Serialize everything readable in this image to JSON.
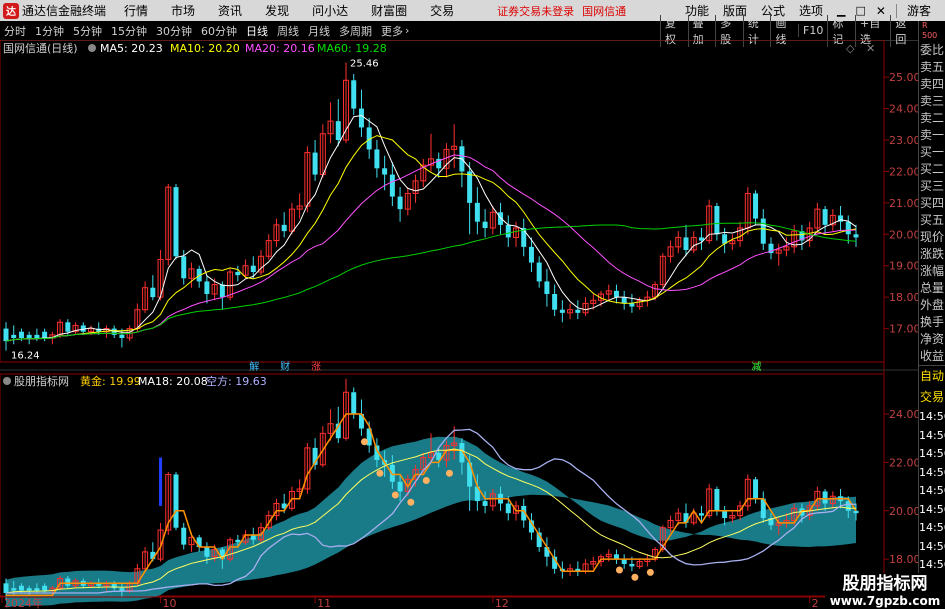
{
  "app": {
    "title": "通达信金融终端",
    "menus": [
      "行情",
      "市场",
      "资讯",
      "发现",
      "问小达",
      "财富圈",
      "交易"
    ],
    "warning": "证券交易未登录",
    "stock_name": "国网信通",
    "right_menus": [
      "功能",
      "版面",
      "公式",
      "选项"
    ],
    "user": "游客"
  },
  "toolbar": {
    "periods": [
      "分时",
      "1分钟",
      "5分钟",
      "15分钟",
      "30分钟",
      "60分钟",
      "日线",
      "周线",
      "月线",
      "多周期",
      "更多"
    ],
    "active_period": "日线",
    "tools": [
      "复权",
      "叠加",
      "多股",
      "统计",
      "画线",
      "F10",
      "标记",
      "+自选",
      "返回"
    ],
    "badge": "R\n500"
  },
  "upper_panel": {
    "label": "国网信通(日线)",
    "ma_labels": [
      {
        "text": "MA5: 20.23",
        "color": "#ffffff"
      },
      {
        "text": "MA10: 20.20",
        "color": "#ffff00"
      },
      {
        "text": "MA20: 20.16",
        "color": "#ff50ff"
      },
      {
        "text": "MA60: 19.28",
        "color": "#00e000"
      }
    ],
    "high_label": "25.46",
    "low_label": "16.24",
    "y_ticks": [
      "25.00",
      "24.00",
      "23.00",
      "22.00",
      "21.00",
      "20.00",
      "19.00",
      "18.00",
      "17.00"
    ],
    "event_markers": [
      {
        "text": "解",
        "color": "#40c0ff"
      },
      {
        "text": "财",
        "color": "#40c0ff"
      },
      {
        "text": "涨",
        "color": "#ff4040"
      },
      {
        "text": "减",
        "color": "#40ff40"
      }
    ]
  },
  "lower_panel": {
    "label": "股朋指标网",
    "values": [
      {
        "text": "黄金: 19.99",
        "color": "#ffcc00"
      },
      {
        "text": "MA18: 20.08",
        "color": "#ffffff"
      },
      {
        "text": "空方: 19.63",
        "color": "#b0b0ff"
      }
    ],
    "y_ticks": [
      "24.00",
      "22.00",
      "20.00",
      "18.00"
    ]
  },
  "x_axis": [
    "2024年",
    "10",
    "11",
    "12",
    "2",
    "3"
  ],
  "right_panel": {
    "quote_rows": [
      "委比",
      "卖五",
      "卖四",
      "卖三",
      "卖二",
      "卖一",
      "买一",
      "买二",
      "买三",
      "买四",
      "买五",
      "现价",
      "涨跌",
      "涨幅",
      "总量",
      "外盘",
      "换手",
      "净资",
      "收益"
    ],
    "auto_label": "自动",
    "trade_label": "交易",
    "times": [
      "14:56",
      "14:56",
      "14:56",
      "14:56",
      "14:56",
      "14:56",
      "14:56",
      "14:56",
      "14:56",
      "14:56"
    ]
  },
  "watermark": {
    "line1": "股朋指标网",
    "line2": "www.7gpzb.com"
  },
  "chart_data": {
    "type": "candlestick",
    "upper_ylim": [
      16.0,
      25.8
    ],
    "lower_ylim": [
      16.6,
      25.2
    ],
    "ohlc": [
      [
        17.0,
        17.2,
        16.6,
        16.3
      ],
      [
        16.8,
        17.1,
        16.7,
        16.5
      ],
      [
        16.9,
        17.0,
        16.7,
        16.6
      ],
      [
        16.8,
        16.9,
        16.7,
        16.5
      ],
      [
        16.8,
        17.0,
        16.7,
        16.6
      ],
      [
        16.9,
        17.0,
        16.7,
        16.6
      ],
      [
        16.7,
        16.9,
        16.8,
        16.5
      ],
      [
        16.8,
        17.3,
        17.2,
        16.7
      ],
      [
        17.2,
        17.3,
        16.9,
        16.8
      ],
      [
        16.9,
        17.2,
        17.1,
        16.8
      ],
      [
        17.1,
        17.2,
        16.9,
        16.8
      ],
      [
        16.9,
        17.1,
        17.0,
        16.8
      ],
      [
        17.0,
        17.2,
        16.9,
        16.8
      ],
      [
        16.9,
        17.1,
        17.0,
        16.7
      ],
      [
        17.0,
        17.1,
        16.8,
        16.7
      ],
      [
        16.8,
        17.0,
        16.7,
        16.4
      ],
      [
        16.7,
        17.1,
        17.0,
        16.6
      ],
      [
        17.0,
        17.8,
        17.6,
        16.9
      ],
      [
        17.6,
        18.5,
        18.3,
        17.5
      ],
      [
        18.3,
        18.7,
        18.0,
        17.9
      ],
      [
        18.0,
        19.5,
        19.2,
        17.9
      ],
      [
        19.2,
        21.6,
        21.5,
        19.0
      ],
      [
        21.5,
        21.6,
        19.3,
        19.2
      ],
      [
        19.3,
        19.5,
        18.6,
        18.4
      ],
      [
        18.6,
        19.1,
        18.9,
        18.3
      ],
      [
        18.9,
        19.0,
        18.5,
        18.3
      ],
      [
        18.5,
        18.7,
        18.1,
        17.8
      ],
      [
        18.1,
        18.6,
        18.4,
        17.9
      ],
      [
        18.4,
        18.5,
        18.0,
        17.6
      ],
      [
        18.0,
        18.9,
        18.8,
        17.9
      ],
      [
        18.8,
        19.0,
        18.7,
        18.5
      ],
      [
        18.7,
        19.2,
        19.0,
        18.6
      ],
      [
        19.0,
        19.3,
        18.8,
        18.6
      ],
      [
        18.8,
        19.5,
        19.3,
        18.7
      ],
      [
        19.3,
        20.0,
        19.8,
        19.2
      ],
      [
        19.8,
        20.5,
        20.3,
        19.6
      ],
      [
        20.3,
        20.7,
        20.1,
        19.9
      ],
      [
        20.1,
        21.0,
        20.8,
        20.0
      ],
      [
        20.8,
        21.3,
        20.9,
        20.5
      ],
      [
        20.9,
        22.8,
        22.6,
        20.7
      ],
      [
        22.6,
        23.0,
        21.9,
        21.7
      ],
      [
        21.9,
        23.5,
        23.2,
        21.8
      ],
      [
        23.2,
        24.2,
        23.6,
        22.9
      ],
      [
        23.6,
        24.3,
        23.0,
        22.8
      ],
      [
        23.0,
        25.46,
        24.9,
        22.9
      ],
      [
        24.9,
        25.1,
        24.0,
        23.8
      ],
      [
        24.0,
        24.6,
        23.4,
        23.1
      ],
      [
        23.4,
        23.7,
        22.7,
        22.4
      ],
      [
        22.7,
        23.0,
        22.1,
        21.8
      ],
      [
        22.1,
        22.5,
        21.9,
        21.4
      ],
      [
        21.9,
        22.3,
        21.2,
        20.9
      ],
      [
        21.2,
        21.5,
        20.8,
        20.4
      ],
      [
        20.8,
        21.5,
        21.3,
        20.6
      ],
      [
        21.3,
        21.9,
        21.7,
        21.0
      ],
      [
        21.7,
        22.4,
        22.2,
        21.5
      ],
      [
        22.2,
        23.2,
        22.4,
        22.0
      ],
      [
        22.4,
        22.6,
        22.1,
        21.8
      ],
      [
        22.1,
        22.9,
        22.7,
        21.8
      ],
      [
        22.7,
        23.5,
        22.8,
        22.1
      ],
      [
        22.8,
        23.0,
        22.0,
        21.5
      ],
      [
        22.0,
        22.3,
        21.0,
        20.0
      ],
      [
        21.0,
        21.5,
        20.4,
        20.0
      ],
      [
        20.4,
        20.8,
        20.2,
        19.9
      ],
      [
        20.2,
        20.9,
        20.7,
        20.0
      ],
      [
        20.7,
        21.0,
        20.3,
        20.0
      ],
      [
        20.3,
        20.6,
        19.9,
        19.6
      ],
      [
        19.9,
        20.4,
        20.2,
        19.6
      ],
      [
        20.2,
        20.5,
        19.6,
        19.3
      ],
      [
        19.6,
        19.9,
        19.1,
        18.8
      ],
      [
        19.1,
        19.3,
        18.5,
        18.3
      ],
      [
        18.5,
        18.9,
        18.1,
        17.7
      ],
      [
        18.1,
        18.4,
        17.6,
        17.4
      ],
      [
        17.6,
        17.9,
        17.5,
        17.2
      ],
      [
        17.5,
        17.8,
        17.6,
        17.3
      ],
      [
        17.6,
        17.9,
        17.5,
        17.3
      ],
      [
        17.5,
        18.0,
        17.8,
        17.4
      ],
      [
        17.8,
        18.1,
        17.9,
        17.6
      ],
      [
        17.9,
        18.2,
        18.1,
        17.7
      ],
      [
        18.1,
        18.4,
        18.2,
        17.9
      ],
      [
        18.2,
        18.4,
        18.0,
        17.8
      ],
      [
        18.0,
        18.2,
        17.8,
        17.6
      ],
      [
        17.8,
        18.1,
        17.7,
        17.5
      ],
      [
        17.7,
        18.0,
        17.9,
        17.6
      ],
      [
        17.9,
        18.2,
        18.0,
        17.7
      ],
      [
        18.0,
        18.5,
        18.4,
        17.9
      ],
      [
        18.4,
        19.4,
        19.3,
        18.3
      ],
      [
        19.3,
        19.8,
        19.6,
        19.1
      ],
      [
        19.6,
        20.1,
        19.9,
        19.4
      ],
      [
        19.9,
        20.3,
        19.5,
        19.3
      ],
      [
        19.5,
        20.1,
        19.9,
        19.4
      ],
      [
        19.9,
        20.2,
        19.8,
        19.5
      ],
      [
        19.8,
        21.1,
        20.9,
        19.7
      ],
      [
        20.9,
        21.0,
        20.0,
        19.8
      ],
      [
        20.0,
        20.2,
        19.7,
        19.4
      ],
      [
        19.7,
        20.0,
        19.8,
        19.5
      ],
      [
        19.8,
        20.4,
        20.2,
        19.6
      ],
      [
        20.2,
        21.5,
        21.3,
        20.0
      ],
      [
        21.3,
        21.4,
        20.5,
        20.3
      ],
      [
        20.5,
        20.8,
        19.7,
        19.5
      ],
      [
        19.7,
        19.9,
        19.4,
        19.2
      ],
      [
        19.4,
        19.7,
        19.5,
        19.0
      ],
      [
        19.5,
        19.9,
        19.6,
        19.3
      ],
      [
        19.6,
        20.3,
        20.1,
        19.4
      ],
      [
        20.1,
        20.3,
        19.8,
        19.5
      ],
      [
        19.8,
        20.4,
        20.2,
        19.6
      ],
      [
        20.2,
        21.0,
        20.8,
        20.0
      ],
      [
        20.8,
        20.9,
        20.3,
        20.0
      ],
      [
        20.3,
        20.8,
        20.6,
        20.1
      ],
      [
        20.6,
        20.9,
        20.4,
        20.1
      ],
      [
        20.4,
        20.6,
        20.0,
        19.7
      ],
      [
        20.0,
        20.3,
        19.9,
        19.6
      ]
    ]
  }
}
